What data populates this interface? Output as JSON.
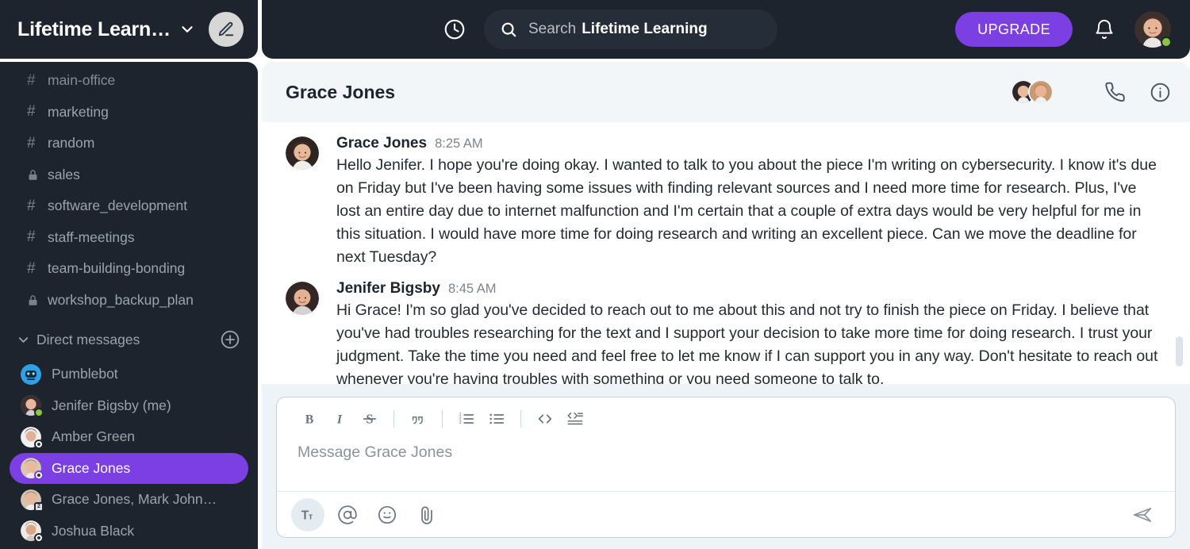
{
  "workspace": {
    "name": "Lifetime Learn…",
    "chevron_icon": "chevron-down-icon",
    "edit_icon": "pencil-icon"
  },
  "sidebar": {
    "channels": [
      {
        "label": "main-office",
        "icon": "hash-icon"
      },
      {
        "label": "marketing",
        "icon": "hash-icon"
      },
      {
        "label": "random",
        "icon": "hash-icon"
      },
      {
        "label": "sales",
        "icon": "lock-icon"
      },
      {
        "label": "software_development",
        "icon": "hash-icon"
      },
      {
        "label": "staff-meetings",
        "icon": "hash-icon"
      },
      {
        "label": "team-building-bonding",
        "icon": "hash-icon"
      },
      {
        "label": "workshop_backup_plan",
        "icon": "lock-icon"
      }
    ],
    "dm_section": {
      "title": "Direct messages",
      "caret_icon": "chevron-down-icon",
      "add_icon": "plus-circle-icon"
    },
    "dms": [
      {
        "label": "Pumblebot",
        "status": "bot",
        "active": false
      },
      {
        "label": "Jenifer Bigsby (me)",
        "status": "online",
        "active": false
      },
      {
        "label": "Amber Green",
        "status": "offline",
        "active": false
      },
      {
        "label": "Grace Jones",
        "status": "offline",
        "active": true
      },
      {
        "label": "Grace Jones, Mark John…",
        "status": "group",
        "group_count": "2",
        "active": false
      },
      {
        "label": "Joshua Black",
        "status": "offline",
        "active": false
      }
    ]
  },
  "topbar": {
    "history_icon": "clock-icon",
    "search": {
      "icon": "search-icon",
      "hint": "Search",
      "value": "Lifetime Learning"
    },
    "upgrade_label": "UPGRADE",
    "notifications_icon": "bell-icon",
    "avatar_icon": "user-avatar",
    "avatar_status": "online"
  },
  "conversation": {
    "title": "Grace Jones",
    "members_icon": "member-avatars",
    "call_icon": "phone-icon",
    "info_icon": "info-circle-icon",
    "messages": [
      {
        "author": "Grace Jones",
        "time": "8:25 AM",
        "text": "Hello Jenifer. I hope you're doing okay. I wanted to talk to you about the piece I'm writing on cybersecurity. I know it's due on Friday but I've been having some issues with finding relevant sources and I need more time for research. Plus, I've lost an entire day due to internet malfunction and I'm certain that a couple of extra days would be very helpful for me in this situation. I would have more time for doing research and writing an excellent piece. Can we move the deadline for next Tuesday?"
      },
      {
        "author": "Jenifer Bigsby",
        "time": "8:45 AM",
        "text": "Hi Grace! I'm so glad you've decided to reach out to me about this and not try to finish the piece on Friday. I believe that you've had troubles researching for the text and I support your decision to take more time for doing research. I trust your judgment. Take the time you need and feel free to let me know if I can support you in any way. Don't hesitate to reach out whenever you're having troubles with something or you need someone to talk to."
      }
    ]
  },
  "composer": {
    "placeholder": "Message Grace Jones",
    "format_tools": [
      {
        "name": "bold-icon",
        "label": "B"
      },
      {
        "name": "italic-icon",
        "label": "I"
      },
      {
        "name": "strikethrough-icon",
        "label": "S"
      },
      {
        "name": "blockquote-icon",
        "label": "””"
      },
      {
        "name": "ordered-list-icon",
        "label": ""
      },
      {
        "name": "bullet-list-icon",
        "label": ""
      },
      {
        "name": "inline-code-icon",
        "label": "<>"
      },
      {
        "name": "code-block-icon",
        "label": ""
      }
    ],
    "actions": [
      {
        "name": "formatting-toggle-icon",
        "label": "Tт"
      },
      {
        "name": "mention-icon",
        "label": "@"
      },
      {
        "name": "emoji-icon",
        "label": ""
      },
      {
        "name": "attachment-icon",
        "label": ""
      }
    ],
    "send_icon": "send-icon"
  },
  "colors": {
    "sidebar_bg": "#1d242e",
    "accent_purple": "#7b3fe4",
    "online_green": "#8ac63f",
    "composer_bg": "#eef3f7",
    "conv_head_bg": "#f2f6f9"
  }
}
